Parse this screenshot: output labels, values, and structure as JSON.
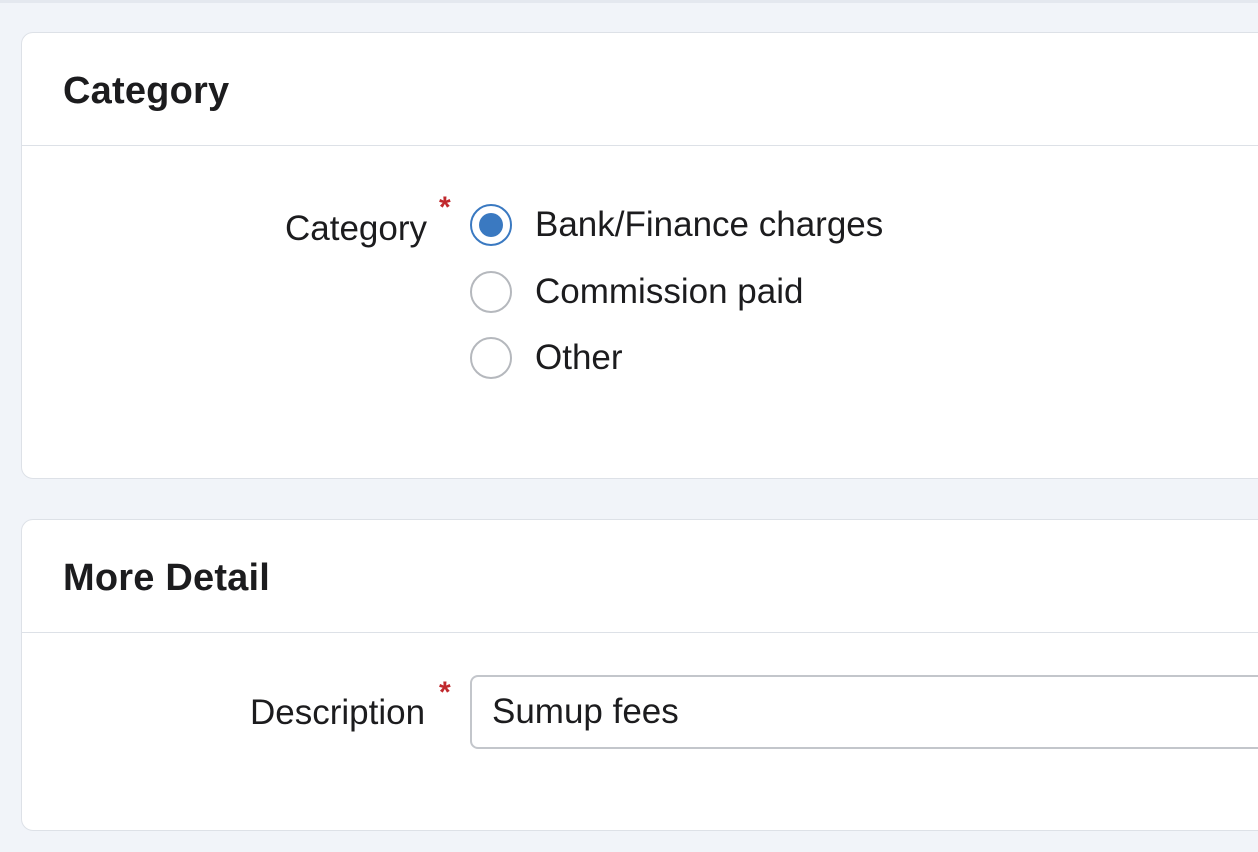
{
  "category_section": {
    "title": "Category",
    "field_label": "Category",
    "required_mark": "*",
    "options": [
      {
        "label": "Bank/Finance charges",
        "checked": true
      },
      {
        "label": "Commission paid",
        "checked": false
      },
      {
        "label": "Other",
        "checked": false
      }
    ]
  },
  "detail_section": {
    "title": "More Detail",
    "description_label": "Description",
    "required_mark": "*",
    "description_value": "Sumup fees"
  },
  "colors": {
    "accent": "#3a79c1",
    "required": "#c0282d",
    "page_background": "#f1f4f9"
  }
}
